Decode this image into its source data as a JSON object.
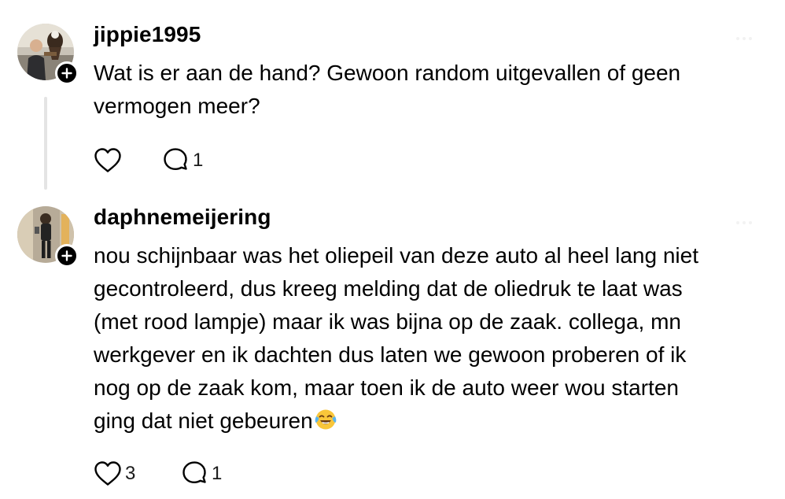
{
  "posts": [
    {
      "username": "jippie1995",
      "text": "Wat is er aan de hand? Gewoon random uitgevallen of geen\nvermogen meer?",
      "likes": "",
      "replies": "1",
      "avatar_icon": "profile-photo-man-with-bird",
      "follow_icon": "plus-icon"
    },
    {
      "username": "daphnemeijering",
      "text": "nou schijnbaar was het oliepeil van deze auto al heel lang niet\ngecontroleerd, dus kreeg melding dat de oliedruk te laat was\n(met rood lampje) maar ik was bijna op de zaak. collega, mn\nwerkgever en ik dachten dus laten we gewoon proberen of ik\nnog op de zaak kom, maar toen ik de auto weer wou starten\nging dat niet gebeuren",
      "emoji": "face-with-tears-of-joy",
      "likes": "3",
      "replies": "1",
      "avatar_icon": "profile-photo-woman-mirror-selfie",
      "follow_icon": "plus-icon"
    }
  ],
  "colors": {
    "text": "#000000",
    "thread_line": "#e4e4e4",
    "icon_stroke": "#000000",
    "badge": "#000000"
  }
}
